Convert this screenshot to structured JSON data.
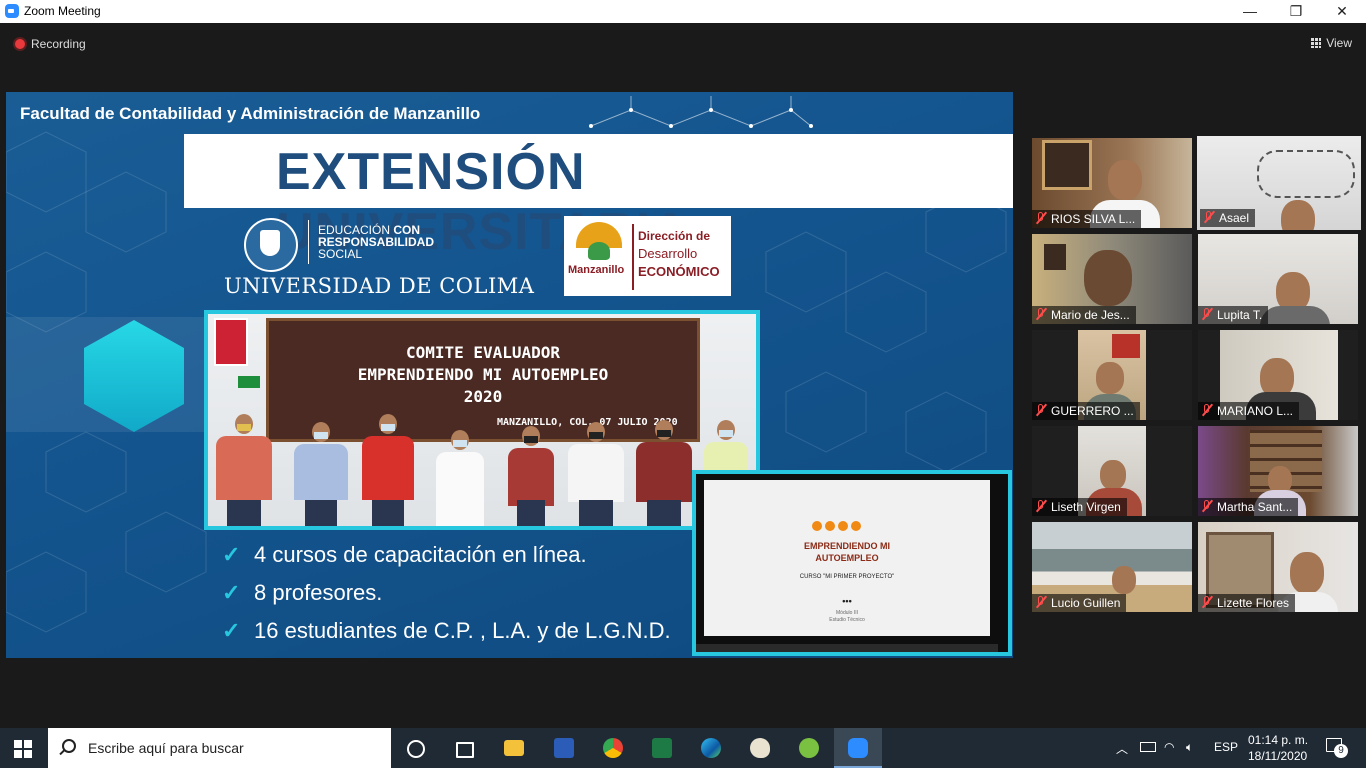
{
  "window": {
    "title": "Zoom Meeting",
    "min": "—",
    "max": "❐",
    "close": "✕"
  },
  "toolbar": {
    "recording_label": "Recording",
    "view_label": "View"
  },
  "slide": {
    "faculty": "Facultad de Contabilidad y Administración de Manzanillo",
    "title": "EXTENSIÓN UNIVERSITARIA",
    "ucol_tag_1": "EDUCACIÓN",
    "ucol_tag_1b": "CON",
    "ucol_tag_2": "RESPONSABILIDAD",
    "ucol_tag_3": "SOCIAL",
    "ucol_name": "UNIVERSIDAD DE COLIMA",
    "mz_city": "Manzanillo",
    "mz_dir_1": "Dirección de",
    "mz_dir_2": "Desarrollo",
    "mz_dir_3": "ECONÓMICO",
    "photo_board_1": "COMITE EVALUADOR",
    "photo_board_2": "EMPRENDIENDO MI AUTOEMPLEO",
    "photo_board_3": "2020",
    "photo_board_4": "MANZANILLO, COL. 07 JULIO 2020",
    "inner_slide": {
      "title_1": "EMPRENDIENDO MI",
      "title_2": "AUTOEMPLEO",
      "course": "CURSO \"MI PRIMER PROYECTO\"",
      "ellipsis": "•••",
      "module": "Módulo III",
      "module_sub": "Estudio Técnico"
    },
    "bullets": [
      "4 cursos de capacitación en línea.",
      "8 profesores.",
      "16 estudiantes de C.P. , L.A. y de L.G.N.D."
    ],
    "check": "✓"
  },
  "participants": [
    {
      "name": "RIOS SILVA L..."
    },
    {
      "name": "Asael"
    },
    {
      "name": "Mario de Jes..."
    },
    {
      "name": "Lupita T."
    },
    {
      "name": "GUERRERO ..."
    },
    {
      "name": "MARIANO L..."
    },
    {
      "name": "Liseth Virgen"
    },
    {
      "name": "Martha Sant..."
    },
    {
      "name": "Lucio Guillen"
    },
    {
      "name": "Lizette Flores"
    }
  ],
  "taskbar": {
    "search_placeholder": "Escribe aquí para buscar",
    "lang": "ESP",
    "time": "01:14 p. m.",
    "date": "18/11/2020",
    "notifications": "9"
  },
  "colors": {
    "accent": "#27c7e0",
    "slide_bg": "#14558f",
    "banner_text": "#1f4d7d",
    "selected_tile": "#b5d93a",
    "mic_muted": "#ff4c4c"
  }
}
